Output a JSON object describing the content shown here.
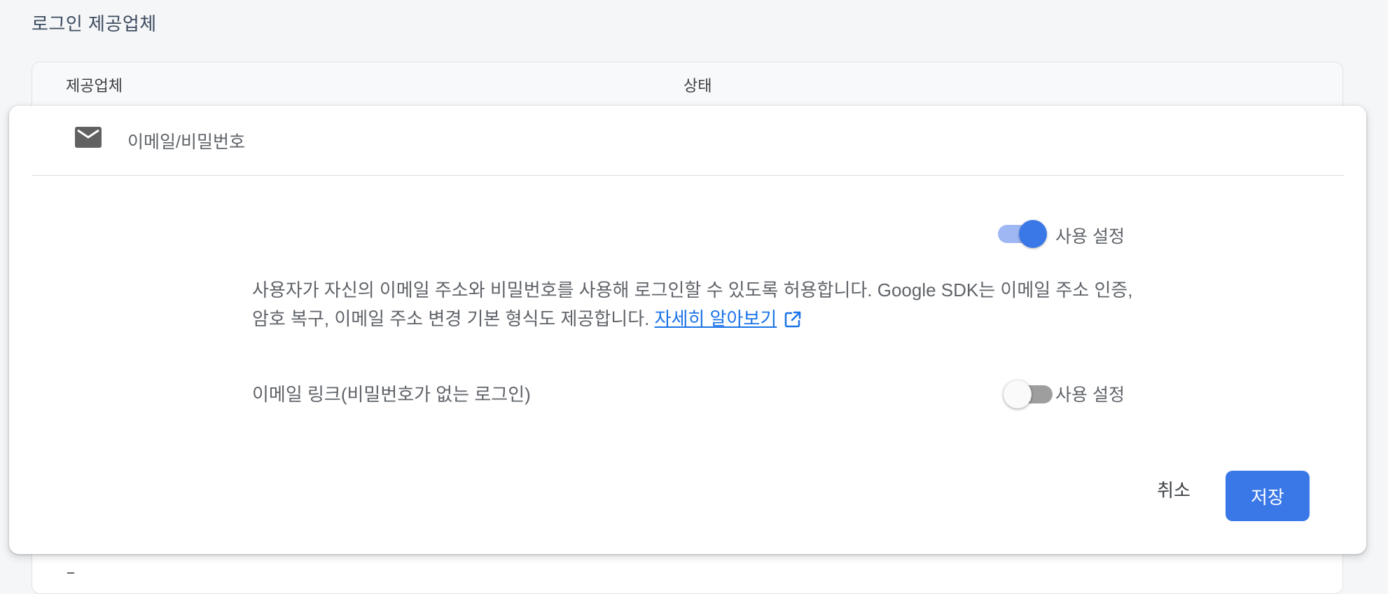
{
  "section": {
    "title": "로그인 제공업체"
  },
  "table": {
    "headers": {
      "provider": "제공업체",
      "status": "상태"
    }
  },
  "panel": {
    "provider_icon": "mail-icon",
    "provider_name": "이메일/비밀번호",
    "enable_toggle": {
      "label": "사용 설정",
      "checked": true
    },
    "description": "사용자가 자신의 이메일 주소와 비밀번호를 사용해 로그인할 수 있도록 허용합니다. Google SDK는 이메일 주소 인증, 암호 복구, 이메일 주소 변경 기본 형식도 제공합니다.",
    "learn_more": "자세히 알아보기",
    "learn_more_icon": "external-link-icon",
    "email_link": {
      "label": "이메일 링크(비밀번호가 없는 로그인)",
      "toggle_label": "사용 설정",
      "checked": false
    },
    "buttons": {
      "cancel": "취소",
      "save": "저장"
    }
  },
  "colors": {
    "accent": "#3a78e7",
    "link": "#1a73e8",
    "toggle_track_on": "#9fb8f3",
    "toggle_track_off": "#9e9e9e"
  }
}
